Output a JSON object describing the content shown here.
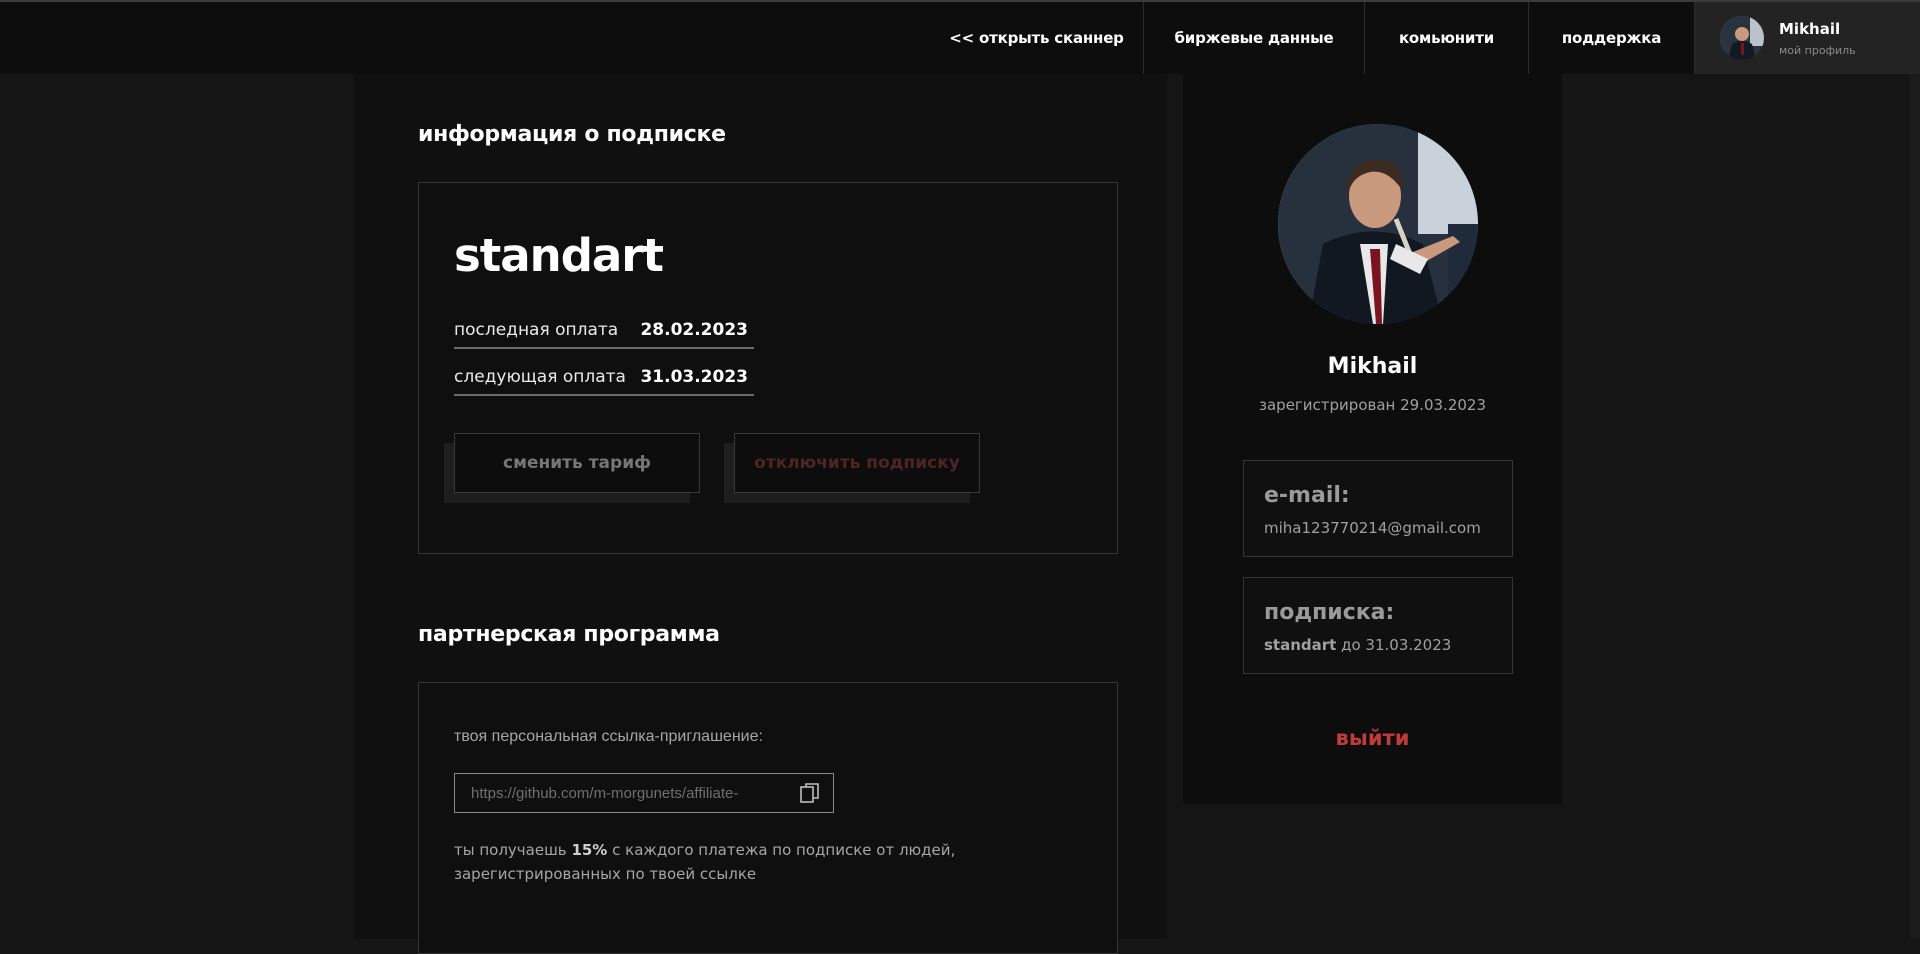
{
  "nav": {
    "scanner": "<< открыть сканнер",
    "market": "биржевые данные",
    "community": "комьюнити",
    "support": "поддержка",
    "profile_name": "Mikhail",
    "profile_sub": "мой профиль"
  },
  "subscription": {
    "section_title": "информация о подписке",
    "plan": "standart",
    "last_payment_label": "последная оплата",
    "last_payment_date": "28.02.2023",
    "next_payment_label": "следующая оплата",
    "next_payment_date": "31.03.2023",
    "change_plan_button": "сменить тариф",
    "cancel_button": "отключить подписку"
  },
  "affiliate": {
    "section_title": "партнерская программа",
    "link_label": "твоя персональная ссылка-приглашение:",
    "link_value": "https://github.com/m-morgunets/affiliate-",
    "note_prefix": "ты получаешь",
    "note_percent": "15%",
    "note_suffix": "с каждого платежа по подписке от людей, зарегистрированных по твоей ссылке"
  },
  "profile": {
    "name": "Mikhail",
    "registered": "зарегистрирован 29.03.2023",
    "email_title": "e-mail:",
    "email_value": "miha123770214@gmail.com",
    "subscription_title": "подписка:",
    "subscription_plan": "standart",
    "subscription_until": "до 31.03.2023",
    "logout": "выйти"
  },
  "colors": {
    "background": "#151515",
    "panel": "#101010",
    "accent_red": "#c23b3b",
    "border": "#353535"
  }
}
